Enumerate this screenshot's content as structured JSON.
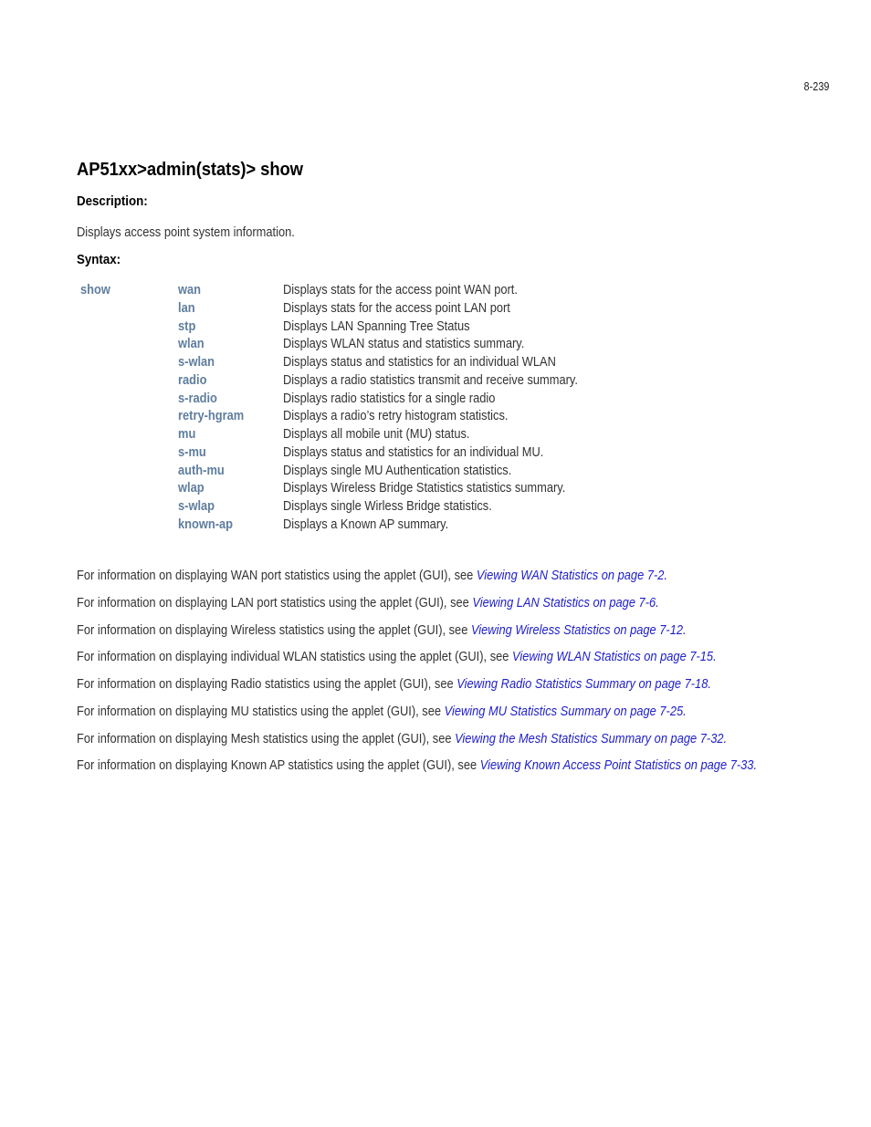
{
  "header": {
    "page_number": "8-239"
  },
  "command": {
    "title": "AP51xx>admin(stats)> show",
    "description_heading": "Description:",
    "description_text": "Displays access point system information.",
    "syntax_heading": "Syntax:",
    "syntax_root": "show"
  },
  "syntax_rows": [
    {
      "keyword": "wan",
      "description": "Displays stats for the access point WAN port."
    },
    {
      "keyword": "lan",
      "description": "Displays stats for the access point LAN port"
    },
    {
      "keyword": "stp",
      "description": "Displays LAN Spanning Tree Status"
    },
    {
      "keyword": "wlan",
      "description": "Displays WLAN status and statistics summary."
    },
    {
      "keyword": "s-wlan",
      "description": "Displays status and statistics for an individual WLAN"
    },
    {
      "keyword": "radio",
      "description": "Displays a radio statistics transmit and receive summary."
    },
    {
      "keyword": "s-radio",
      "description": "Displays radio statistics for a single radio"
    },
    {
      "keyword": "retry-hgram",
      "description": "Displays a radio’s retry histogram statistics."
    },
    {
      "keyword": "mu",
      "description": "Displays all mobile unit (MU) status."
    },
    {
      "keyword": "s-mu",
      "description": "Displays status and statistics for an individual MU."
    },
    {
      "keyword": "auth-mu",
      "description": "Displays single MU Authentication statistics."
    },
    {
      "keyword": "wlap",
      "description": "Displays Wireless Bridge Statistics statistics summary."
    },
    {
      "keyword": "s-wlap",
      "description": "Displays single Wirless Bridge statistics."
    },
    {
      "keyword": "known-ap",
      "description": "Displays a Known AP summary."
    }
  ],
  "cross_references": [
    {
      "text": "For information on displaying WAN port statistics using the applet (GUI), see ",
      "link": "Viewing WAN Statistics on page 7-2."
    },
    {
      "text": "For information on displaying LAN port statistics using the applet (GUI), see ",
      "link": "Viewing LAN Statistics on page 7-6."
    },
    {
      "text": "For information on displaying Wireless statistics using the applet (GUI), see ",
      "link": "Viewing Wireless Statistics on page 7-12."
    },
    {
      "text": "For information on displaying individual WLAN statistics using the applet (GUI), see ",
      "link": "Viewing WLAN Statistics on page 7-15."
    },
    {
      "text": "For information on displaying Radio statistics using the applet (GUI), see ",
      "link": "Viewing Radio Statistics Summary on page 7-18."
    },
    {
      "text": "For information on displaying MU statistics using the applet (GUI), see ",
      "link": "Viewing MU Statistics Summary on page 7-25."
    },
    {
      "text": "For information on displaying Mesh statistics using the applet (GUI), see ",
      "link": "Viewing the Mesh Statistics Summary on page 7-32."
    },
    {
      "text": "For information on displaying Known AP statistics using the applet (GUI), see ",
      "link": "Viewing Known Access Point Statistics on page 7-33."
    }
  ],
  "colors": {
    "keyword_blue": "#5f7e9e",
    "link_blue": "#2020cc",
    "body_text": "#333333"
  }
}
